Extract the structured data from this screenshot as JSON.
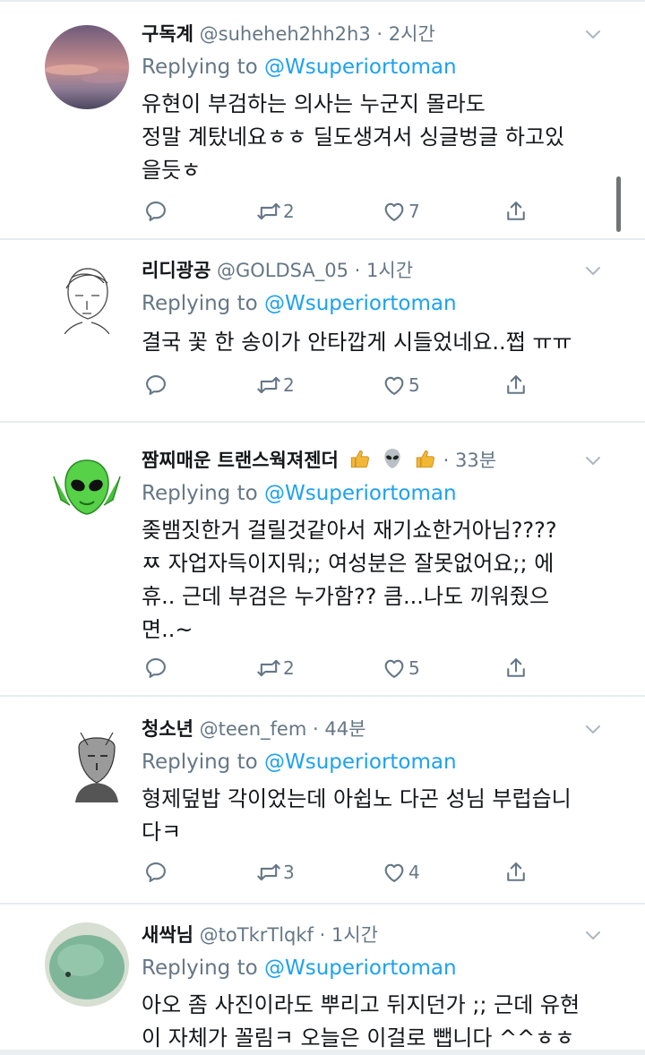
{
  "colors": {
    "link": "#1da1f2",
    "secondary": "#657786",
    "separator": "#e6ecf0"
  },
  "icons": [
    "chevron-down-icon",
    "reply-icon",
    "retweet-icon",
    "like-icon",
    "share-icon",
    "thumbs-up-emoji",
    "alien-emoji"
  ],
  "replying_prefix": "Replying to",
  "tweets": [
    {
      "name": "구독계",
      "handle": "@suheheh2hh2h3",
      "separator": "·",
      "time": "2시간",
      "replying_to": "@Wsuperiortoman",
      "text": "유현이 부검하는 의사는 누군지 몰라도\n정말 계탔네요ㅎㅎ 딜도생겨서 싱글벙글 하고있\n을듯ㅎ",
      "retweets": "2",
      "likes": "7"
    },
    {
      "name": "리디광공",
      "handle": "@GOLDSA_05",
      "separator": "·",
      "time": "1시간",
      "replying_to": "@Wsuperiortoman",
      "text": "결국 꽃 한 송이가 안타깝게 시들었네요..쩝 ㅠㅠ",
      "retweets": "2",
      "likes": "5"
    },
    {
      "name": "짬찌매운 트랜스웍져젠더",
      "handle": "",
      "separator": "·",
      "time": "33분",
      "replying_to": "@Wsuperiortoman",
      "text": "좆뱀짓한거 걸릴것같아서 재기쇼한거아님????\nㅉ 자업자득이지뭐;; 여성분은 잘못없어요;; 에\n휴.. 근데 부검은 누가함?? 큼...나도 끼워줬으\n면..~",
      "retweets": "2",
      "likes": "5"
    },
    {
      "name": "청소년",
      "handle": "@teen_fem",
      "separator": "·",
      "time": "44분",
      "replying_to": "@Wsuperiortoman",
      "text": "형제덮밥 각이었는데 아쉽노 다곤 성님 부럽습니\n다ㅋ",
      "retweets": "3",
      "likes": "4"
    },
    {
      "name": "새싹님",
      "handle": "@toTkrTlqkf",
      "separator": "·",
      "time": "1시간",
      "replying_to": "@Wsuperiortoman",
      "text": "아오 좀 사진이라도 뿌리고 뒤지던가 ;; 근데 유현\n이 자체가 꼴림ㅋ 오늘은 이걸로 뺍니다 ^^ㅎㅎ"
    }
  ]
}
